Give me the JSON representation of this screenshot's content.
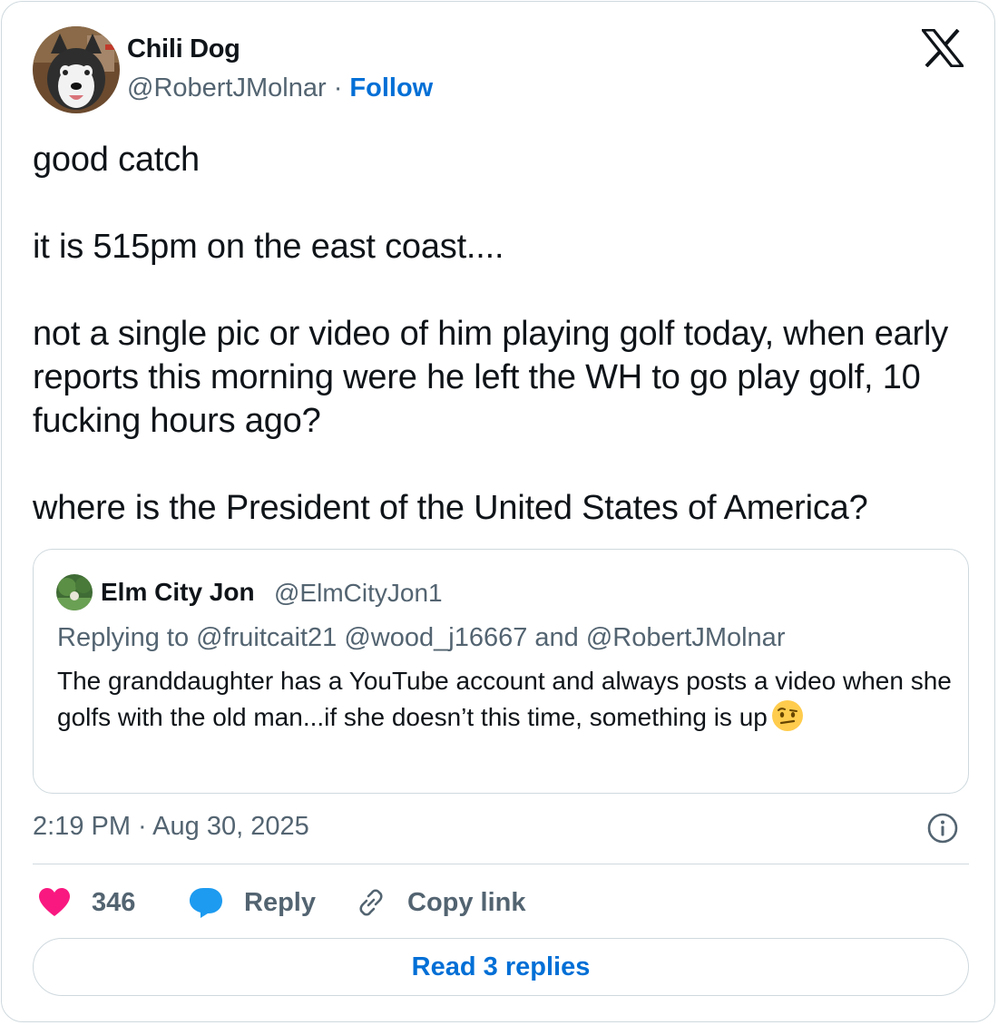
{
  "colors": {
    "link": "#006fd6",
    "secondary_text": "#536471",
    "border": "#cfd9de",
    "heart": "#f91880",
    "reply_bubble": "#1d9bf0",
    "emoji_face": "#ffcc4d"
  },
  "author": {
    "display_name": "Chili Dog",
    "handle": "@RobertJMolnar",
    "separator": "·",
    "follow_label": "Follow",
    "avatar_icon": "husky-dog-avatar"
  },
  "platform_icon": "x-logo-icon",
  "tweet": {
    "paragraphs": [
      "good catch",
      "it is 515pm on the east coast....",
      "not a single pic or video of him playing golf today, when early reports this morning were he left the WH to go play golf, 10 fucking hours ago?",
      "where is the President of the United States of America?"
    ],
    "timestamp": "2:19 PM · Aug 30, 2025"
  },
  "quoted_tweet": {
    "display_name": "Elm City Jon",
    "handle": "@ElmCityJon1",
    "replying_to": "Replying to @fruitcait21 @wood_j16667 and @RobertJMolnar",
    "text": "The granddaughter has a YouTube account and always posts a video when she golfs with the old man...if she doesn’t this time, something is up",
    "emoji": "face-with-raised-eyebrow-emoji",
    "avatar_icon": "green-landscape-avatar"
  },
  "actions": {
    "like_count": "346",
    "reply_label": "Reply",
    "copy_link_label": "Copy link"
  },
  "read_replies_label": "Read 3 replies"
}
